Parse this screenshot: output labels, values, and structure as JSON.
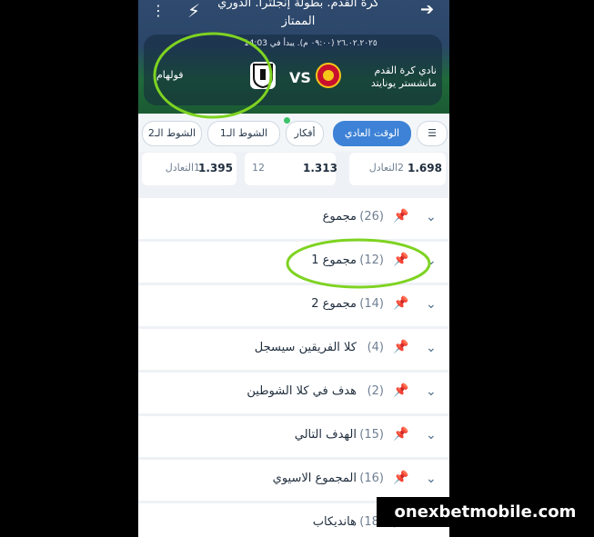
{
  "header": {
    "league_line1": "كرة القدم. بطولة إنجلترا. الدوري",
    "league_line2": "الممتاز",
    "datetime": "٢٦.٠٢.٢٠٢٥ (٠٩:٠٠ م). يبدأ في 14:03",
    "home_team_line1": "نادي كرة القدم",
    "home_team_line2": "مانشستر يونايتد",
    "vs": "VS",
    "away_team": "فولهام"
  },
  "tabs": [
    {
      "label": "الوقت العادي",
      "active": true
    },
    {
      "label": "أفكار",
      "active": false
    },
    {
      "label": "الشوط الـ1",
      "active": false
    },
    {
      "label": "الشوط الـ2",
      "active": false
    }
  ],
  "odds": [
    {
      "label": "1التعادل",
      "value": "1.395"
    },
    {
      "label": "12",
      "value": "1.313"
    },
    {
      "label": "2التعادل",
      "value": "1.698"
    }
  ],
  "markets": [
    {
      "count": "(26)",
      "name": "مجموع"
    },
    {
      "count": "(12)",
      "name": "مجموع 1"
    },
    {
      "count": "(14)",
      "name": "مجموع 2"
    },
    {
      "count": "(4)",
      "name": "كلا الفريقين سيسجل"
    },
    {
      "count": "(2)",
      "name": "هدف في كلا الشوطين"
    },
    {
      "count": "(15)",
      "name": "الهدف التالي"
    },
    {
      "count": "(16)",
      "name": "المجموع الاسيوي"
    },
    {
      "count": "(18)",
      "name": "هانديكاب"
    }
  ],
  "watermark": "onexbetmobile.com",
  "colors": {
    "accent": "#3d82d6",
    "highlight": "#7ed321"
  }
}
